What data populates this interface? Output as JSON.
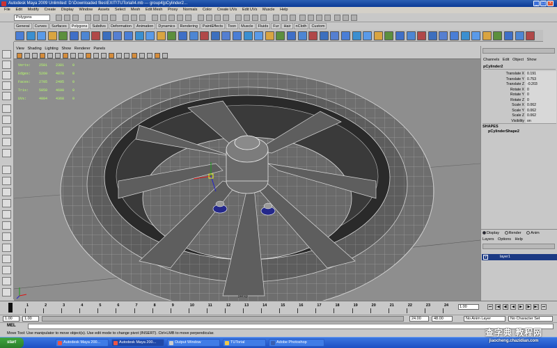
{
  "window": {
    "title": "Autodesk Maya 2009 Unlimited: D:\\Downloaded files\\EXIT\\TUTorial\\4.mb  ---  group4|pCylinder2..."
  },
  "menu": [
    "File",
    "Edit",
    "Modify",
    "Create",
    "Display",
    "Window",
    "Assets",
    "Select",
    "Mesh",
    "Edit Mesh",
    "Proxy",
    "Normals",
    "Color",
    "Create UVs",
    "Edit UVs",
    "Muscle",
    "Help"
  ],
  "status": {
    "mode": "Polygons"
  },
  "shelf_tabs": [
    "General",
    "Curves",
    "Surfaces",
    "Polygons",
    "Subdivs",
    "Deformation",
    "Animation",
    "Dynamics",
    "Rendering",
    "PaintEffects",
    "Toon",
    "Muscle",
    "Fluids",
    "Fur",
    "Hair",
    "nCloth",
    "Custom"
  ],
  "shelf_active": "Polygons",
  "viewport": {
    "menu": [
      "View",
      "Shading",
      "Lighting",
      "Show",
      "Renderer",
      "Panels"
    ],
    "hud": [
      {
        "label": "Verts:",
        "a": "2581",
        "b": "2381",
        "c": "0"
      },
      {
        "label": "Edges:",
        "a": "5260",
        "b": "4878",
        "c": "0"
      },
      {
        "label": "Faces:",
        "a": "2705",
        "b": "2495",
        "c": "0"
      },
      {
        "label": "Tris:",
        "a": "5050",
        "b": "4690",
        "c": "0"
      },
      {
        "label": "UVs:",
        "a": "4084",
        "b": "4368",
        "c": "0"
      }
    ],
    "camera_label": "persp"
  },
  "channels": {
    "menu": [
      "Channels",
      "Edit",
      "Object",
      "Show"
    ],
    "object": "pCylinder2",
    "attributes": [
      {
        "name": "Translate X",
        "value": "0.191"
      },
      {
        "name": "Translate Y",
        "value": "0.753"
      },
      {
        "name": "Translate Z",
        "value": "-0.203"
      },
      {
        "name": "Rotate X",
        "value": "0"
      },
      {
        "name": "Rotate Y",
        "value": "0"
      },
      {
        "name": "Rotate Z",
        "value": "0"
      },
      {
        "name": "Scale X",
        "value": "0.062"
      },
      {
        "name": "Scale Y",
        "value": "0.062"
      },
      {
        "name": "Scale Z",
        "value": "0.062"
      },
      {
        "name": "Visibility",
        "value": "on"
      }
    ],
    "shapes_label": "SHAPES",
    "shape": "pCylinderShape2"
  },
  "layers": {
    "options": [
      "Display",
      "Render",
      "Anim"
    ],
    "menu": [
      "Layers",
      "Options",
      "Help"
    ],
    "layer_v": "V",
    "layer_name": "layer1"
  },
  "time": {
    "ticks": [
      "1",
      "2",
      "3",
      "4",
      "5",
      "6",
      "7",
      "8",
      "9",
      "10",
      "11",
      "12",
      "13",
      "14",
      "15",
      "16",
      "17",
      "18",
      "19",
      "20",
      "21",
      "22",
      "23",
      "24"
    ],
    "current": "1.00",
    "start": "1.00",
    "range_start": "1.00",
    "range_end": "24.00",
    "end": "48.00",
    "anim_layer": "No Anim Layer",
    "char_set": "No Character Set"
  },
  "mel": {
    "label": "MEL"
  },
  "help": "Move Tool: Use manipulator to move object(s). Use edit mode to change pivot (INSERT). Ctrl+LMB to move perpendicular.",
  "taskbar": {
    "start": "start",
    "items": [
      "Autodesk Maya 200...",
      "Autodesk Maya 200...",
      "Output Window",
      "TUTorial",
      "Adobe Photoshop"
    ]
  },
  "watermark": {
    "line1": "查字典 教程网",
    "line2": "jiaocheng.chazidian.com"
  },
  "colors": {
    "viewport": "#8e8e8e",
    "hud": "#b7ff6a",
    "layer_selected": "#1c3a84",
    "taskbar": "#2a5ed0"
  }
}
